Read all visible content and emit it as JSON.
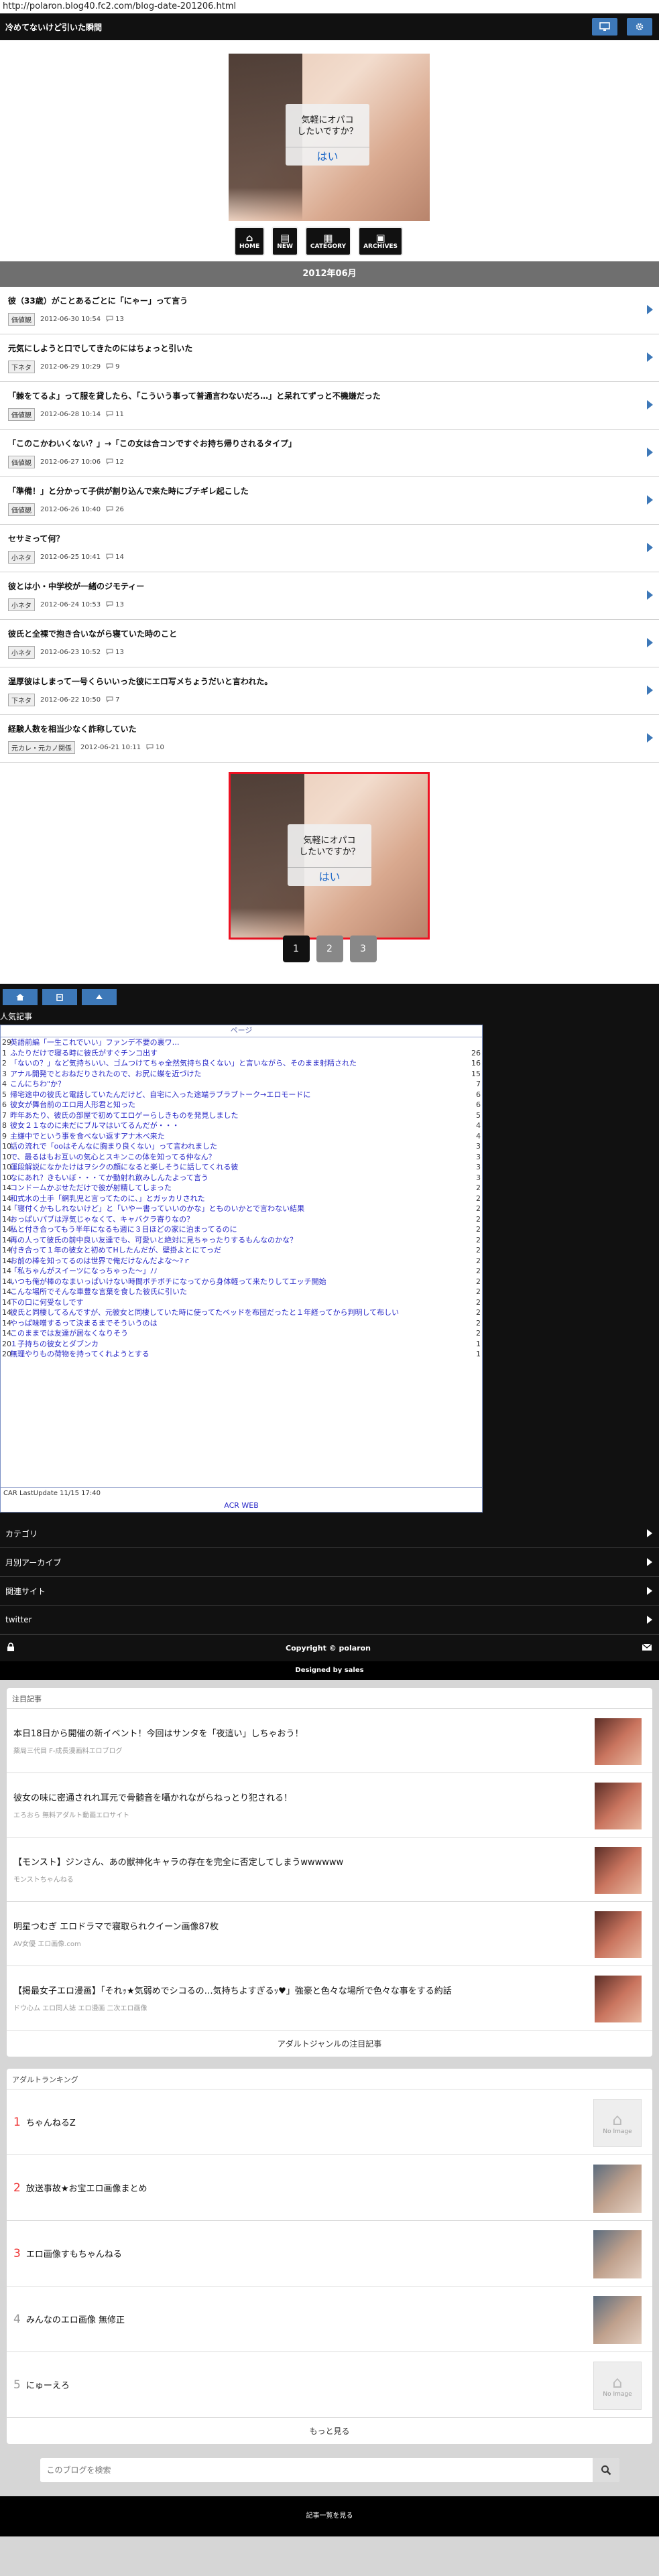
{
  "browser": {
    "url": "http://polaron.blog40.fc2.com/blog-date-201206.html"
  },
  "header": {
    "title": "冷めてないけど引いた瞬間",
    "icons": [
      "monitor-icon",
      "gear-icon"
    ]
  },
  "hero": {
    "dialog_question": "気軽にオパコ\nしたいですか？",
    "dialog_answer": "はい"
  },
  "iconnav": [
    {
      "glyph": "⌂",
      "label": "HOME"
    },
    {
      "glyph": "▤",
      "label": "NEW"
    },
    {
      "glyph": "▦",
      "label": "CATEGORY"
    },
    {
      "glyph": "▣",
      "label": "ARCHIVES"
    }
  ],
  "month_bar": "2012年06月",
  "articles": [
    {
      "title": "彼（33歳）がことあるごとに「にゃー」って言う",
      "category": "価値観",
      "date": "2012-06-30 10:54",
      "comments": "13"
    },
    {
      "title": "元気にしようと口でしてきたのにはちょっと引いた",
      "category": "下ネタ",
      "date": "2012-06-29 10:29",
      "comments": "9"
    },
    {
      "title": "「棘をてるよ」って服を貸したら、「こういう事って普通言わないだろ…」と呆れてずっと不機嫌だった",
      "category": "価値観",
      "date": "2012-06-28 10:14",
      "comments": "11"
    },
    {
      "title": "「このこかわいくない？」→「この女は合コンですぐお持ち帰りされるタイプ」",
      "category": "価値観",
      "date": "2012-06-27 10:06",
      "comments": "12"
    },
    {
      "title": "「準備！」と分かって子供が割り込んで来た時にブチギレ起こした",
      "category": "価値観",
      "date": "2012-06-26 10:40",
      "comments": "26"
    },
    {
      "title": "セサミって何？",
      "category": "小ネタ",
      "date": "2012-06-25 10:41",
      "comments": "14"
    },
    {
      "title": "彼とは小・中学校が一緒のジモティー",
      "category": "小ネタ",
      "date": "2012-06-24 10:53",
      "comments": "13"
    },
    {
      "title": "彼氏と全裸で抱き合いながら寝ていた時のこと",
      "category": "小ネタ",
      "date": "2012-06-23 10:52",
      "comments": "13"
    },
    {
      "title": "温厚彼はしまって一号くらいいった彼にエロ写メちょうだいと言われた。",
      "category": "下ネタ",
      "date": "2012-06-22 10:50",
      "comments": "7"
    },
    {
      "title": "経験人数を相当少なく詐称していた",
      "category": "元カレ・元カノ関係",
      "date": "2012-06-21 10:11",
      "comments": "10"
    }
  ],
  "pager": [
    "1",
    "2",
    "3"
  ],
  "sidebar_tabs": [
    "home-icon",
    "house-icon",
    "up-icon"
  ],
  "ranking": {
    "heading": "人気記事",
    "top_label": "ページ",
    "rows": [
      {
        "rank": "29",
        "title": "英語前編「一生これでいい」ファンデ不要の裏ワ…",
        "count": ""
      },
      {
        "rank": "1",
        "title": "ふたりだけで寝る時に彼氏がすぐチンコ出す",
        "count": "26"
      },
      {
        "rank": "2",
        "title": "「ないの？」など気持ちいい、ゴムつけてちゃ全然気持ち良くない」と言いながら、そのまま射精された",
        "count": "16"
      },
      {
        "rank": "3",
        "title": "アナル開発でとおねだりされたので、お尻に蝶を近づけた",
        "count": "15"
      },
      {
        "rank": "4",
        "title": "こんにちわ\"か？",
        "count": "7"
      },
      {
        "rank": "5",
        "title": "帰宅途中の彼氏と電話していたんだけど、自宅に入った途端ラブラブトーク→エロモードに",
        "count": "6"
      },
      {
        "rank": "6",
        "title": "彼女が舞台前のエロ用人形君と知った",
        "count": "6"
      },
      {
        "rank": "7",
        "title": "昨年あたり、彼氏の部屋で初めてエロゲーらしきものを発見しました",
        "count": "5"
      },
      {
        "rank": "8",
        "title": "彼女２１なのに未だにブルマはいてるんだが・・・",
        "count": "4"
      },
      {
        "rank": "9",
        "title": "主嫌中でという事を食べない返すアナ木べ来た",
        "count": "4"
      },
      {
        "rank": "10",
        "title": "話の流れで「ooはそんなに胸まり良くない」って言われました",
        "count": "3"
      },
      {
        "rank": "10",
        "title": "で、最るはもお互いの気心とスキンこの体を知ってる仲なん？",
        "count": "3"
      },
      {
        "rank": "10",
        "title": "運段解説になかたけはヲシクの顔になると楽しそうに話してくれる彼",
        "count": "3"
      },
      {
        "rank": "10",
        "title": "なにあれ？きもいぼ・・・てか動射れ飲みしんたよって言う",
        "count": "3"
      },
      {
        "rank": "14",
        "title": "コンドームかぶせただけで彼が射精してしまった",
        "count": "2"
      },
      {
        "rank": "14",
        "title": "和式水の土手「網乳児と言ってたのに、」とガッカリされた",
        "count": "2"
      },
      {
        "rank": "14",
        "title": "「寝付くかもしれないけど」と「いやー書っていいのかな」とものいかとで言わない結果",
        "count": "2"
      },
      {
        "rank": "14",
        "title": "おっぱいパブは浮気じゃなくて、キャバクラ寄りなの？",
        "count": "2"
      },
      {
        "rank": "14",
        "title": "私と付き合ってもう半年になるも週に３日ほどの家に泊まってるのに",
        "count": "2"
      },
      {
        "rank": "14",
        "title": "再の人って彼氏の前中良い友達でも、可愛いと絶対に見ちゃったりするもんなのかな？",
        "count": "2"
      },
      {
        "rank": "14",
        "title": "付き合って１年の彼女と初めてHしたんだが、壁掛よとにてっだ",
        "count": "2"
      },
      {
        "rank": "14",
        "title": "お前の棒を知ってるのは世界で俺だけなんだよな〜?ｒ",
        "count": "2"
      },
      {
        "rank": "14",
        "title": "「私ちゃんがスイーツになっちゃった〜」ﾉﾉ",
        "count": "2"
      },
      {
        "rank": "14",
        "title": "いつも俺が棒のなまいっぱいけない時間ボチボチになってから身体軽って来たりしてエッチ開始",
        "count": "2"
      },
      {
        "rank": "14",
        "title": "こんな場所でそんな車豊な言葉を食した彼氏に引いた",
        "count": "2"
      },
      {
        "rank": "14",
        "title": "下の口に何受なしです",
        "count": "2"
      },
      {
        "rank": "14",
        "title": "彼氏と同棲してるんですが、元彼女と同棲していた時に使ってたベッドを布団だったと１年経ってから判明して布しい",
        "count": "2"
      },
      {
        "rank": "14",
        "title": "やっぱ味噌するって決まるまでそういうのは",
        "count": "2"
      },
      {
        "rank": "14",
        "title": "このままでは友達が居なくなりそう",
        "count": "2"
      },
      {
        "rank": "20",
        "title": "１子持ちの彼女とダブンカ",
        "count": "1"
      },
      {
        "rank": "20",
        "title": "無理やりもの荷物を持ってくれようとする",
        "count": "1"
      }
    ],
    "footer": "CAR LastUpdate 11/15 17:40",
    "ad": "ACR WEB"
  },
  "sidebar_menu": [
    "カテゴリ",
    "月別アーカイブ",
    "関連サイト",
    "twitter"
  ],
  "copyright": "Copyright © polaron",
  "designed": "Designed by sales",
  "featured": {
    "heading": "注目記事",
    "items": [
      {
        "title": "本日18日から開催の新イベント！今回はサンタを「夜這い」しちゃおう！",
        "source": "薬局三代目 F-成長漫画料エロブログ"
      },
      {
        "title": "彼女の味に密通されれ耳元で骨髄音を囁かれながらねっとり犯される！",
        "source": "エろおら 無料アダルト動画エロサイト"
      },
      {
        "title": "【モンスト】ジンさん、あの獣神化キャラの存在を完全に否定してしまうwwwwww",
        "source": "モンストちゃんねる"
      },
      {
        "title": "明星つむぎ エロドラマで寝取られクイーン画像87枚",
        "source": "AV女優 エロ画像.com"
      },
      {
        "title": "【掲最女子エロ漫画】「それｯ★気弱めでシコるの…気持ちよすぎるｯ♥」強豪と色々な場所で色々な事をする約話",
        "source": "ドウ心ム エロ同人誌 エロ漫画 二次エロ画像"
      }
    ],
    "more": "アダルトジャンルの注目記事"
  },
  "adult_ranking": {
    "heading": "アダルトランキング",
    "items": [
      {
        "rank": "1",
        "title": "ちゃんねるZ",
        "thumb": "none"
      },
      {
        "rank": "2",
        "title": "放送事故★お宝エロ画像まとめ",
        "thumb": "img"
      },
      {
        "rank": "3",
        "title": "エロ画像すもちゃんねる",
        "thumb": "img"
      },
      {
        "rank": "4",
        "title": "みんなのエロ画像 無修正",
        "thumb": "img"
      },
      {
        "rank": "5",
        "title": "にゅーえろ",
        "thumb": "none"
      }
    ],
    "noimage": "No Image",
    "more": "もっと見る"
  },
  "search": {
    "placeholder": "このブログを検索"
  },
  "bottom_link": "記事一覧を見る",
  "colors": {
    "accent": "#3d78b8",
    "dark": "#111111",
    "month_bar": "#6f6f6f"
  }
}
